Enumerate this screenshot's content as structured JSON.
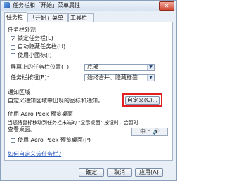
{
  "window": {
    "title": "任务栏和「开始」菜单属性",
    "close_glyph": "✕"
  },
  "tabs": [
    {
      "label": "任务栏"
    },
    {
      "label": "「开始」菜单"
    },
    {
      "label": "工具栏"
    }
  ],
  "appearance": {
    "heading": "任务栏外观",
    "lock_taskbar": {
      "label": "锁定任务栏(L)",
      "checked": true
    },
    "auto_hide": {
      "label": "自动隐藏任务栏(U)",
      "checked": false
    },
    "small_icons": {
      "label": "使用小图标(I)",
      "checked": false
    },
    "position_label": "屏幕上的任务栏位置(T):",
    "position_value": "底部",
    "buttons_label": "任务栏按钮(B):",
    "buttons_value": "始终合并、隐藏标签"
  },
  "notification": {
    "heading": "通知区域",
    "description": "自定义通知区域中出现的图标和通知。",
    "customize_button": "自定义(C)..."
  },
  "aero_peek": {
    "heading": "使用 Aero Peek 预览桌面",
    "description_line1": "当您将鼠标移动到任务栏末端的 \"显示桌面\" 按钮时，会暂时",
    "description_line2": "查看桌面。",
    "checkbox_label": "使用 Aero Peek 预览桌面(P)",
    "checked": false,
    "preview_text": "中 ⌂ 🔊"
  },
  "help_link": "如何自定义该任务栏?",
  "footer": {
    "ok": "确定",
    "cancel": "取消",
    "apply": "应用(A)"
  },
  "colors": {
    "highlight": "#e02020",
    "link": "#2f5fbf"
  }
}
